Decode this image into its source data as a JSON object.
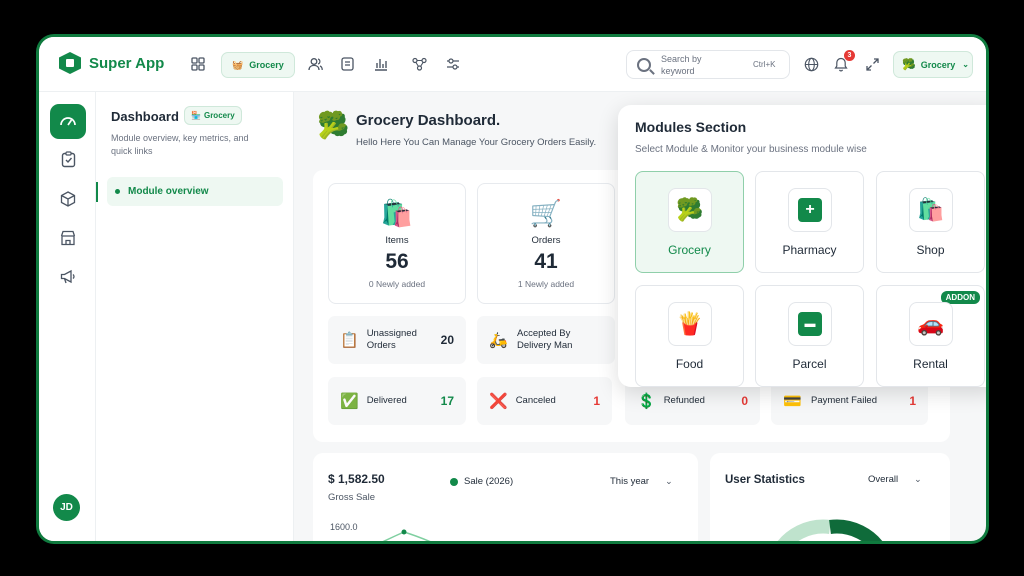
{
  "app": {
    "name": "Super App"
  },
  "topbar": {
    "module_pill": "Grocery",
    "search_placeholder": "Search by keyword",
    "search_shortcut": "Ctrl+K",
    "notifications_count": "3",
    "module_select": "Grocery"
  },
  "subsidebar": {
    "title": "Dashboard",
    "tag": "Grocery",
    "description": "Module overview, key metrics, and quick links",
    "items": [
      {
        "label": "Module overview"
      }
    ]
  },
  "avatar_initials": "JD",
  "main": {
    "title": "Grocery Dashboard.",
    "subtitle": "Hello Here You Can Manage Your Grocery Orders Easily."
  },
  "stats": [
    {
      "label": "Items",
      "value": "56",
      "note": "0 Newly added",
      "icon": "grocery-bag-icon"
    },
    {
      "label": "Orders",
      "value": "41",
      "note": "1 Newly added",
      "icon": "shopping-cart-icon"
    }
  ],
  "order_status": [
    {
      "label": "Unassigned Orders",
      "value": "20",
      "color": "dark",
      "icon": "clipboard-icon"
    },
    {
      "label": "Accepted By Delivery Man",
      "value": "",
      "color": "dark",
      "icon": "delivery-man-icon"
    },
    {
      "label": "Delivered",
      "value": "17",
      "color": "green",
      "icon": "delivered-icon"
    },
    {
      "label": "Canceled",
      "value": "1",
      "color": "red",
      "icon": "canceled-icon"
    },
    {
      "label": "Refunded",
      "value": "0",
      "color": "red",
      "icon": "refund-icon"
    },
    {
      "label": "Payment Failed",
      "value": "1",
      "color": "red",
      "icon": "payment-failed-icon"
    }
  ],
  "sales": {
    "amount": "$ 1,582.50",
    "label": "Gross Sale",
    "legend": "Sale (2026)",
    "period": "This year",
    "y_tick": "1600.0"
  },
  "user_stats": {
    "title": "User Statistics",
    "filter": "Overall"
  },
  "modules": {
    "title": "Modules Section",
    "subtitle": "Select Module & Monitor your business module wise",
    "addon_label": "ADDON",
    "items": [
      {
        "label": "Grocery",
        "icon": "broccoli-icon",
        "active": true
      },
      {
        "label": "Pharmacy",
        "icon": "medical-kit-icon",
        "active": false
      },
      {
        "label": "Shop",
        "icon": "shopping-bag-icon",
        "active": false
      },
      {
        "label": "Food",
        "icon": "fries-icon",
        "active": false
      },
      {
        "label": "Parcel",
        "icon": "parcel-box-icon",
        "active": false
      },
      {
        "label": "Rental",
        "icon": "car-icon",
        "active": false,
        "addon": true
      }
    ]
  },
  "colors": {
    "brand": "#12894a",
    "danger": "#e53935",
    "brand_light": "#eef8f2"
  }
}
